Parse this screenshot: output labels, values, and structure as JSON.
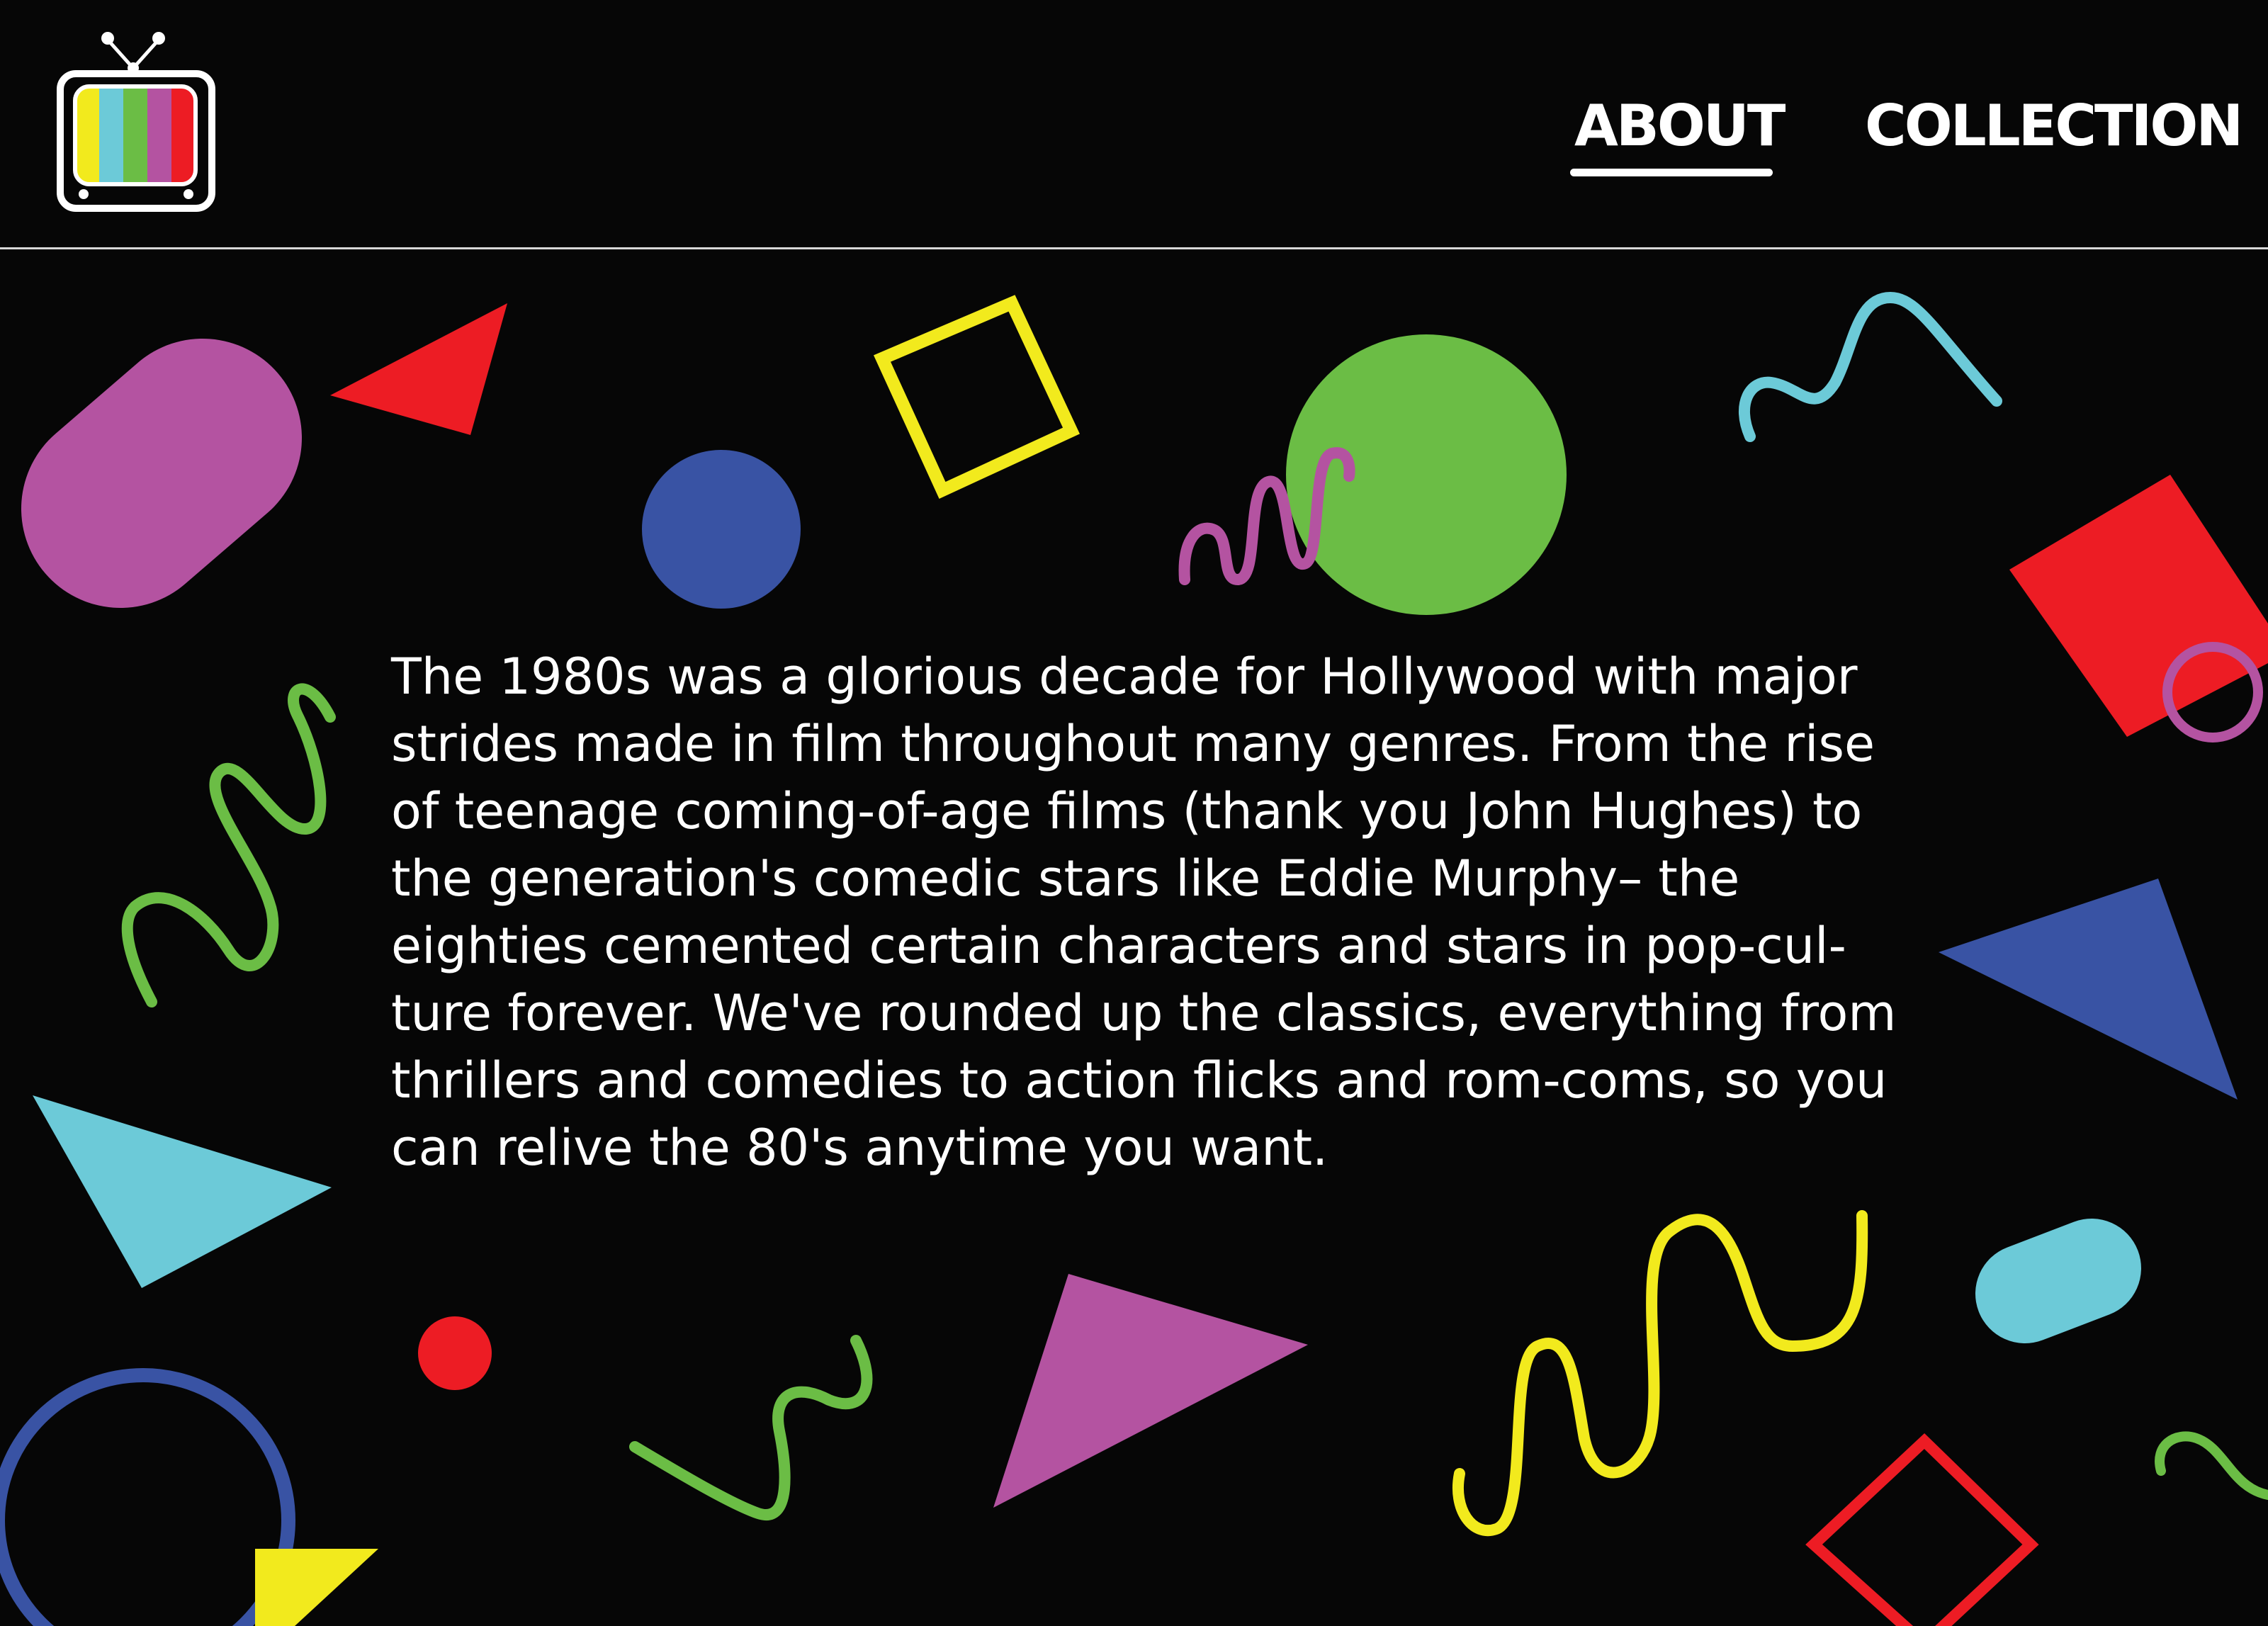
{
  "header": {
    "logo_icon": "retro-tv-icon",
    "logo_colors": [
      "#f2ea1d",
      "#6ccad8",
      "#6bbd45",
      "#b453a1",
      "#ed1c24"
    ],
    "nav": [
      {
        "label": "ABOUT",
        "active": true
      },
      {
        "label": "COLLECTION",
        "active": false
      }
    ]
  },
  "main": {
    "intro_lines": [
      "The 1980s was a glorious decade for Hollywood with major",
      "strides made in film throughout many genres. From the rise",
      "of teenage coming-of-age films (thank you John Hughes) to",
      "the generation's comedic stars like Eddie Murphy– the",
      "eighties cemented certain characters and stars in pop-cul-",
      "ture forever. We've rounded up the classics, everything from",
      "thrillers and comedies to action flicks and rom-coms, so you",
      "can relive the 80's anytime you want."
    ]
  },
  "palette": {
    "background": "#060606",
    "red": "#ed1c24",
    "yellow": "#f2ea1d",
    "green": "#6bbd45",
    "blue": "#3953a4",
    "cyan": "#6ccad8",
    "purple": "#b453a1",
    "white": "#ffffff"
  }
}
